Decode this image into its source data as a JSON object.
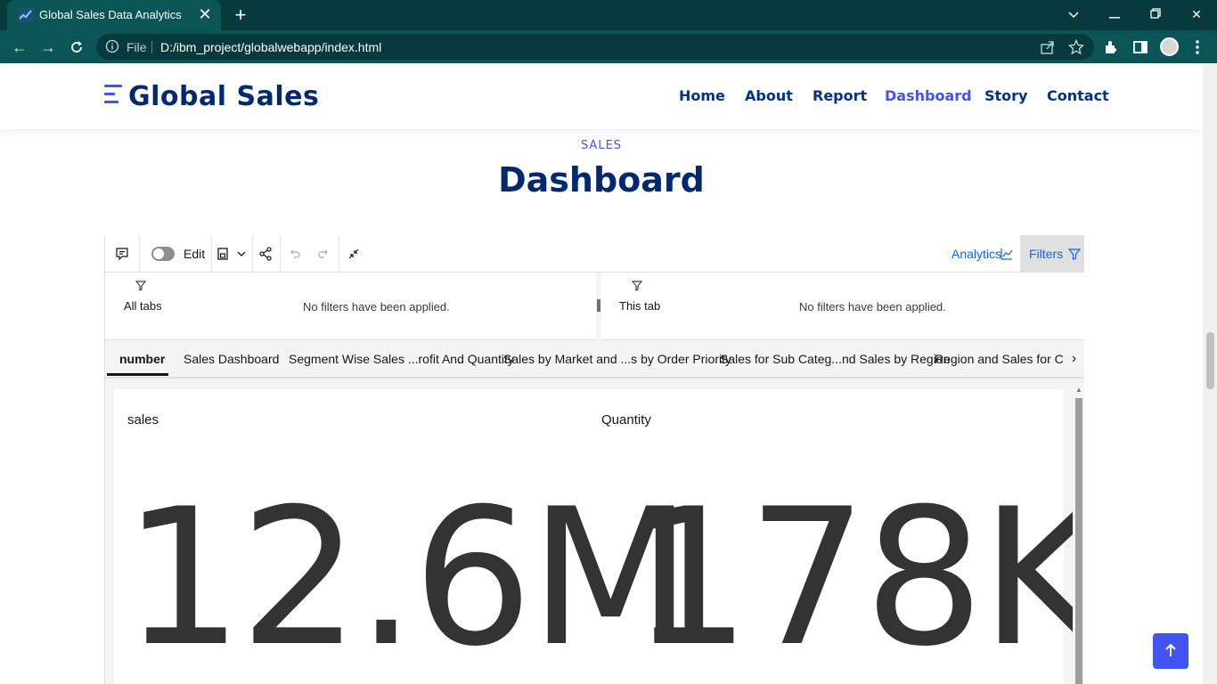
{
  "browser": {
    "tab_title": "Global Sales Data Analytics",
    "url_scheme": "File",
    "url": "D:/ibm_project/globalwebapp/index.html"
  },
  "site": {
    "logo_text": "Global Sales",
    "nav": [
      "Home",
      "About",
      "Report",
      "Dashboard",
      "Story",
      "Contact"
    ],
    "active_nav": "Dashboard"
  },
  "section": {
    "subtitle": "SALES",
    "title": "Dashboard"
  },
  "dashboard": {
    "toolbar": {
      "edit_label": "Edit",
      "analytics_label": "Analytics",
      "filters_label": "Filters"
    },
    "filters": [
      {
        "scope": "All tabs",
        "message": "No filters have been applied."
      },
      {
        "scope": "This tab",
        "message": "No filters have been applied."
      }
    ],
    "tabs": [
      "number",
      "Sales Dashboard",
      "Segment Wise Sales ...rofit And Quantity",
      "Sales by Market and ...s by Order Priority",
      "Sales for Sub Categ...nd Sales by Region",
      "Region and Sales for Countr"
    ],
    "active_tab": "number",
    "kpis": [
      {
        "label": "sales",
        "value": "12.6M"
      },
      {
        "label": "Quantity",
        "value": "178K"
      }
    ]
  },
  "colors": {
    "brand": "#4154f1",
    "heading": "#012970",
    "browser_frame": "#0c5557",
    "ibm_blue": "#0f62fe"
  }
}
